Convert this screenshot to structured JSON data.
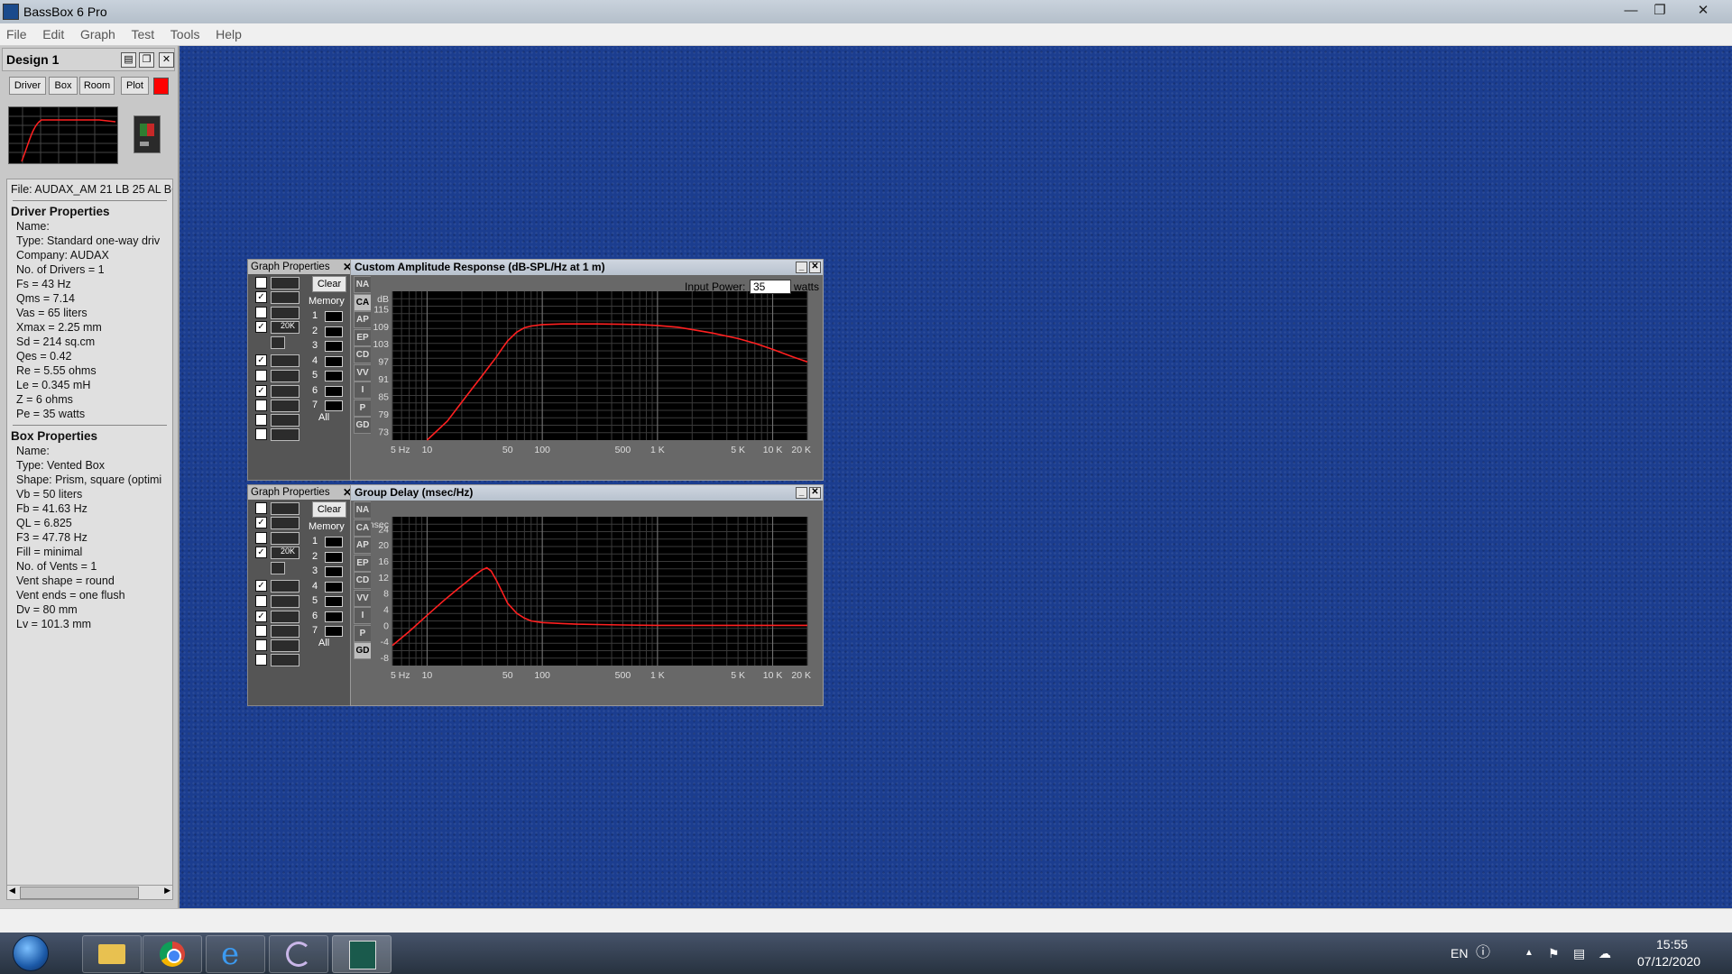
{
  "app": {
    "title": "BassBox 6 Pro"
  },
  "menu": [
    "File",
    "Edit",
    "Graph",
    "Test",
    "Tools",
    "Help"
  ],
  "design": {
    "title": "Design 1",
    "tabs": [
      "Driver",
      "Box",
      "Room",
      "Plot"
    ],
    "plot_color": "#ff0000",
    "file_line": "File: AUDAX_AM 21 LB 25 AL BC",
    "driver_header": "Driver Properties",
    "driver_props": [
      "Name:",
      "Type: Standard one-way driv",
      "Company: AUDAX",
      "No. of Drivers = 1",
      "Fs = 43 Hz",
      "Qms = 7.14",
      "Vas = 65 liters",
      "Xmax = 2.25 mm",
      "Sd = 214 sq.cm",
      "Qes = 0.42",
      "Re = 5.55 ohms",
      "Le = 0.345 mH",
      "Z = 6 ohms",
      "Pe = 35 watts"
    ],
    "box_header": "Box Properties",
    "box_props": [
      "Name:",
      "Type: Vented Box",
      "Shape: Prism, square (optimi",
      "Vb = 50 liters",
      "Fb = 41.63 Hz",
      "QL = 6.825",
      "F3 = 47.78 Hz",
      "Fill = minimal",
      "No. of Vents = 1",
      "Vent shape = round",
      "Vent ends = one flush",
      "Dv = 80 mm",
      "Lv = 101.3 mm"
    ]
  },
  "graph_properties": {
    "title": "Graph Properties",
    "clear_label": "Clear",
    "memory_label": "Memory",
    "memory_slots": [
      "1",
      "2",
      "3",
      "4",
      "5",
      "6",
      "7"
    ],
    "all_label": "All",
    "options_top": {
      "checked": [
        false,
        true,
        false,
        true
      ],
      "labels": [
        "",
        "",
        "",
        ""
      ],
      "scale_label": "20K"
    },
    "options_bottom": {
      "checked": [
        true,
        false,
        true,
        false,
        false,
        false
      ]
    }
  },
  "graph_tabs": [
    "NA",
    "CA",
    "AP",
    "EP",
    "CD",
    "VV",
    "I",
    "P",
    "GD"
  ],
  "amplitude": {
    "title": "Custom Amplitude Response (dB-SPL/Hz at 1 m)",
    "input_power_label": "Input Power:",
    "input_power_value": "35",
    "input_power_unit": "watts",
    "active_tab": "CA"
  },
  "group_delay": {
    "title": "Group Delay (msec/Hz)",
    "active_tab": "GD"
  },
  "chart_data": [
    {
      "type": "line",
      "title": "Custom Amplitude Response (dB-SPL/Hz at 1 m)",
      "ylabel": "dB",
      "yticks": [
        "115",
        "109",
        "103",
        "97",
        "91",
        "85",
        "79",
        "73"
      ],
      "ytick_values": [
        115,
        109,
        103,
        97,
        91,
        85,
        79,
        73
      ],
      "ylim": [
        70,
        121
      ],
      "xscale": "log",
      "xlim": [
        5,
        20000
      ],
      "xtick_labels": [
        "5 Hz",
        "10",
        "50",
        "100",
        "500",
        "1 K",
        "5 K",
        "10 K",
        "20 K"
      ],
      "xtick_values": [
        5,
        10,
        50,
        100,
        500,
        1000,
        5000,
        10000,
        20000
      ],
      "grid": true,
      "series": [
        {
          "color": "#ff2020",
          "x": [
            10,
            15,
            20,
            25,
            30,
            35,
            40,
            45,
            50,
            60,
            70,
            80,
            100,
            150,
            200,
            300,
            500,
            700,
            1000,
            1500,
            2000,
            3000,
            5000,
            7000,
            10000,
            15000,
            20000
          ],
          "y": [
            70,
            76.5,
            83,
            88,
            92,
            95.5,
            98.5,
            101.5,
            104,
            107,
            108.5,
            109.1,
            109.6,
            109.8,
            109.8,
            109.8,
            109.7,
            109.6,
            109.3,
            108.7,
            107.9,
            106.7,
            104.8,
            103.2,
            101.1,
            98.5,
            96.8
          ]
        }
      ]
    },
    {
      "type": "line",
      "title": "Group Delay (msec/Hz)",
      "ylabel": "msec",
      "yticks": [
        "24",
        "20",
        "16",
        "12",
        "8",
        "4",
        "0",
        "-4",
        "-8"
      ],
      "ytick_values": [
        24,
        20,
        16,
        12,
        8,
        4,
        0,
        -4,
        -8
      ],
      "ylim": [
        -10,
        27
      ],
      "xscale": "log",
      "xlim": [
        5,
        20000
      ],
      "xtick_labels": [
        "5 Hz",
        "10",
        "50",
        "100",
        "500",
        "1 K",
        "5 K",
        "10 K",
        "20 K"
      ],
      "xtick_values": [
        5,
        10,
        50,
        100,
        500,
        1000,
        5000,
        10000,
        20000
      ],
      "grid": true,
      "series": [
        {
          "color": "#ff2020",
          "x": [
            5,
            7,
            10,
            14,
            18,
            22,
            26,
            30,
            33,
            36,
            40,
            45,
            50,
            60,
            70,
            80,
            100,
            150,
            200,
            300,
            500,
            1000,
            2000,
            5000,
            10000,
            20000
          ],
          "y": [
            -5,
            -1.5,
            2.5,
            6.2,
            8.8,
            10.8,
            12.5,
            13.8,
            14.3,
            13.5,
            11.2,
            8.2,
            5.5,
            3,
            1.8,
            1.1,
            0.7,
            0.45,
            0.3,
            0.2,
            0.1,
            0,
            0,
            0,
            0,
            0
          ]
        }
      ]
    }
  ],
  "taskbar": {
    "language": "EN",
    "time": "15:55",
    "date": "07/12/2020"
  }
}
